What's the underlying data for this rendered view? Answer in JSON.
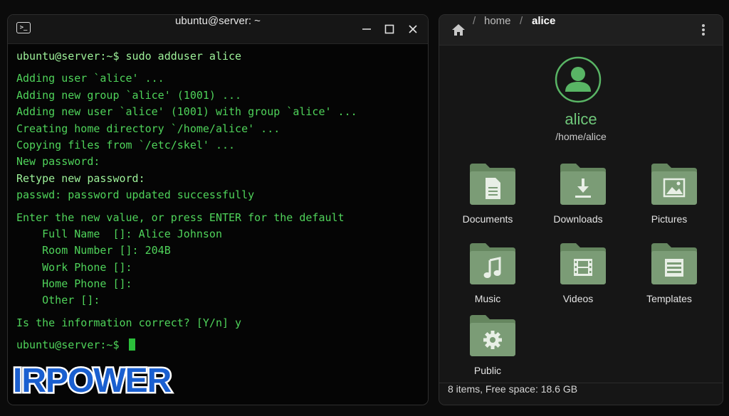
{
  "terminal": {
    "title": "ubuntu@server: ~",
    "lines": [
      "ubuntu@server:~$ sudo adduser alice",
      "Adding user `alice' ...",
      "Adding new group `alice' (1001) ...",
      "Adding new user `alice' (1001) with group `alice' ...",
      "Creating home directory `/home/alice' ...",
      "Copying files from `/etc/skel' ...",
      "New password:",
      "Retype new password:",
      "passwd: password updated successfully",
      "Enter the new value, or press ENTER for the default",
      "    Full Name  []: Alice Johnson",
      "    Room Number []: 204B",
      "    Work Phone []:",
      "    Home Phone []:",
      "    Other []:",
      "Is the information correct? [Y/n] y",
      "ubuntu@server:~$ "
    ]
  },
  "watermark": {
    "text": "IRPOWER"
  },
  "file_manager": {
    "breadcrumb": [
      "home",
      "alice"
    ],
    "user": {
      "name": "alice",
      "home_path": "/home/alice"
    },
    "folders": [
      {
        "label": "Documents",
        "icon": "document-icon"
      },
      {
        "label": "Downloads",
        "icon": "download-icon"
      },
      {
        "label": "Pictures",
        "icon": "image-icon"
      },
      {
        "label": "Music",
        "icon": "music-note-icon"
      },
      {
        "label": "Videos",
        "icon": "film-icon"
      },
      {
        "label": "Templates",
        "icon": "template-icon"
      },
      {
        "label": "Public",
        "icon": "gear-icon"
      }
    ],
    "status": "8 items, Free space: 18.6 GB"
  },
  "colors": {
    "terminal_green": "#4fd35a",
    "accent_green": "#6fc77a",
    "folder_green": "#7c9d78",
    "logo_blue": "#1a5fd0"
  }
}
